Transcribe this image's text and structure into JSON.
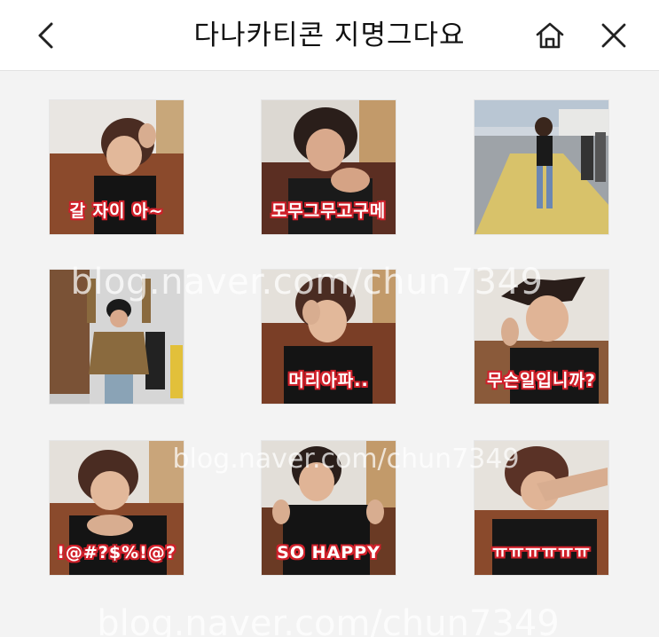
{
  "header": {
    "title": "다나카티콘 지명그다요"
  },
  "stickers": [
    {
      "caption": "갈 자이 아~",
      "bg": "#8c5a3c"
    },
    {
      "caption": "모무그무고구메",
      "bg": "#5a3d2c"
    },
    {
      "caption": "",
      "bg": "#c9ccd0"
    },
    {
      "caption": "",
      "bg": "#6a5a4a"
    },
    {
      "caption": "머리아파..",
      "bg": "#7a4f35"
    },
    {
      "caption": "무슨일입니까?",
      "bg": "#d6d0c8"
    },
    {
      "caption": "!@#?$%!@?",
      "bg": "#8a5a3a"
    },
    {
      "caption": "SO HAPPY",
      "bg": "#6a4a35"
    },
    {
      "caption": "ㅠㅠㅠㅠㅠㅠ",
      "bg": "#9a6a4a"
    }
  ],
  "watermark": {
    "line1": "blog.naver.com/chun7349",
    "line2": "blog.naver.com/chun7349",
    "line3": "blog.naver.com/chun7349"
  },
  "icons": {
    "back": "chevron-left-icon",
    "home": "home-icon",
    "close": "close-icon"
  }
}
